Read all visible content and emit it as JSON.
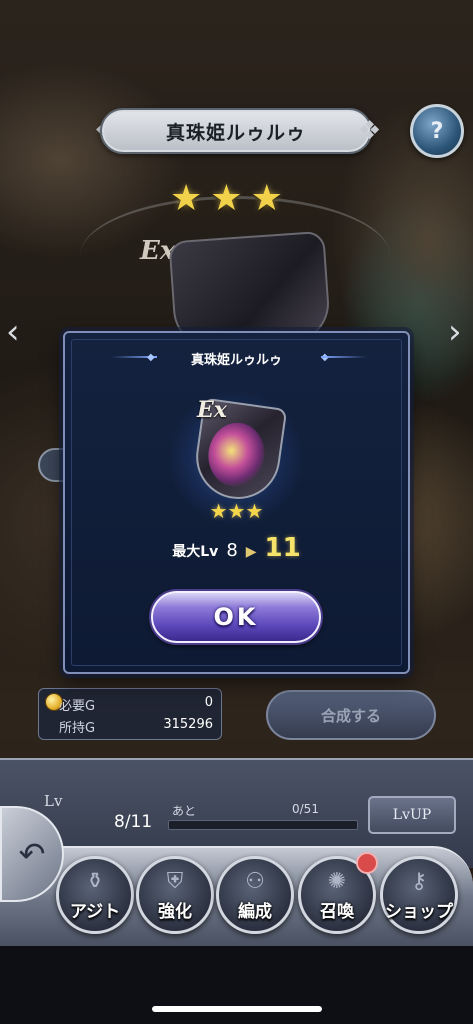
{
  "header": {
    "title": "真珠姫ルゥルゥ",
    "help_icon": "question-icon"
  },
  "item": {
    "rarity_stars": 3,
    "grade": "Ex",
    "icon": "shield-icon"
  },
  "modal": {
    "title": "真珠姫ルゥルゥ",
    "grade": "Ex",
    "stars": "★★★",
    "max_lv_label": "最大Lv",
    "max_lv_old": "8",
    "max_lv_new": "11",
    "ok_label": "OK"
  },
  "gold": {
    "required_label": "必要G",
    "required_value": "0",
    "owned_label": "所持G",
    "owned_value": "315296"
  },
  "fuse_button": "合成する",
  "level": {
    "label": "Lv",
    "current": "8/11",
    "remaining_label": "あと",
    "exp": "0/51",
    "exp_progress": 0,
    "lvup_label": "LvUP"
  },
  "nav": {
    "items": [
      {
        "label": "アジト",
        "icon": "potion-icon"
      },
      {
        "label": "強化",
        "icon": "armor-icon"
      },
      {
        "label": "編成",
        "icon": "party-icon"
      },
      {
        "label": "召喚",
        "icon": "summon-icon"
      },
      {
        "label": "ショップ",
        "icon": "shop-icon"
      }
    ]
  },
  "colors": {
    "modal_bg": "#14223f",
    "ok_button": "#5a45b8",
    "star": "#f1d24a",
    "new_level": "#f6e46a"
  }
}
